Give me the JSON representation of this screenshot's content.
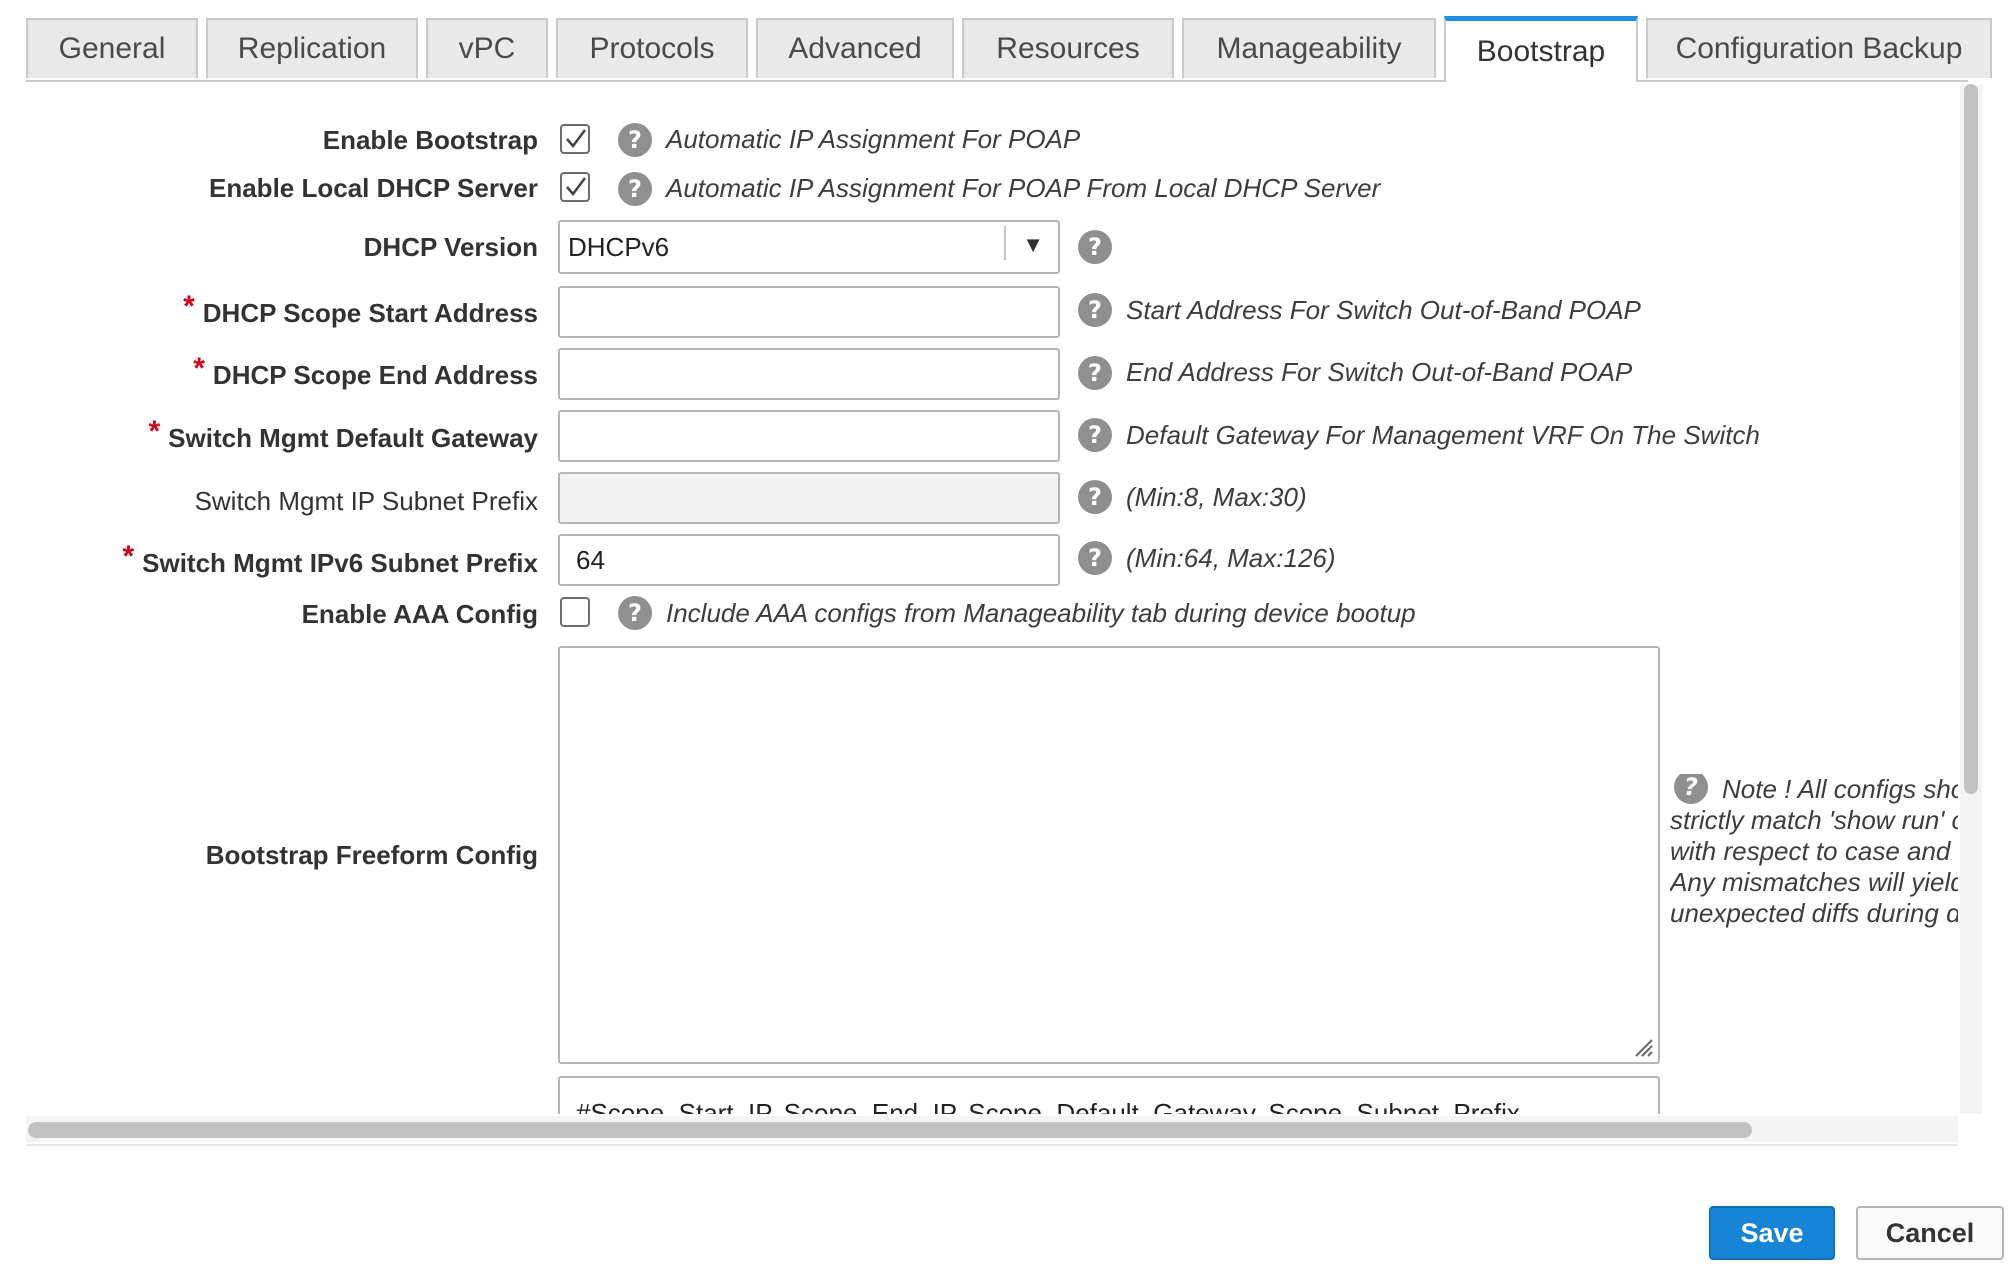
{
  "tabs": [
    {
      "label": "General",
      "active": false
    },
    {
      "label": "Replication",
      "active": false
    },
    {
      "label": "vPC",
      "active": false
    },
    {
      "label": "Protocols",
      "active": false
    },
    {
      "label": "Advanced",
      "active": false
    },
    {
      "label": "Resources",
      "active": false
    },
    {
      "label": "Manageability",
      "active": false
    },
    {
      "label": "Bootstrap",
      "active": true
    },
    {
      "label": "Configuration Backup",
      "active": false
    }
  ],
  "form": {
    "enable_bootstrap": {
      "label": "Enable Bootstrap",
      "checked": true,
      "hint": "Automatic IP Assignment For POAP"
    },
    "enable_local_dhcp": {
      "label": "Enable Local DHCP Server",
      "checked": true,
      "hint": "Automatic IP Assignment For POAP From Local DHCP Server"
    },
    "dhcp_version": {
      "label": "DHCP Version",
      "value": "DHCPv6"
    },
    "scope_start": {
      "required_mark": "*",
      "label": "DHCP Scope Start Address",
      "value": "",
      "hint": "Start Address For Switch Out-of-Band POAP"
    },
    "scope_end": {
      "required_mark": "*",
      "label": "DHCP Scope End Address",
      "value": "",
      "hint": "End Address For Switch Out-of-Band POAP"
    },
    "default_gateway": {
      "required_mark": "*",
      "label": "Switch Mgmt Default Gateway",
      "value": "",
      "hint": "Default Gateway For Management VRF On The Switch"
    },
    "ip_subnet_prefix": {
      "label": "Switch Mgmt IP Subnet Prefix",
      "value": "",
      "hint": "(Min:8, Max:30)"
    },
    "ipv6_subnet_prefix": {
      "required_mark": "*",
      "label": "Switch Mgmt IPv6 Subnet Prefix",
      "value": "64",
      "hint": "(Min:64, Max:126)"
    },
    "enable_aaa": {
      "label": "Enable AAA Config",
      "checked": false,
      "hint": "Include AAA configs from Manageability tab during device bootup"
    },
    "freeform": {
      "label": "Bootstrap Freeform Config",
      "value": "",
      "note_lines": [
        "Note ! All configs sho",
        "strictly match 'show run' c",
        "with respect to case and",
        "Any mismatches will yield",
        "unexpected diffs during d"
      ]
    },
    "scope_field_text": "#Scope_Start_IP, Scope_End_IP, Scope_Default_Gateway, Scope_Subnet_Prefix"
  },
  "help_glyph": "?",
  "icons": {
    "help": "question-circle-icon",
    "dropdown": "triangle-down-icon",
    "check": "checkmark-icon"
  },
  "colors": {
    "accent": "#1e8fe0",
    "save_button": "#1784d8",
    "required": "#d0021b"
  },
  "buttons": {
    "save": "Save",
    "cancel": "Cancel"
  }
}
